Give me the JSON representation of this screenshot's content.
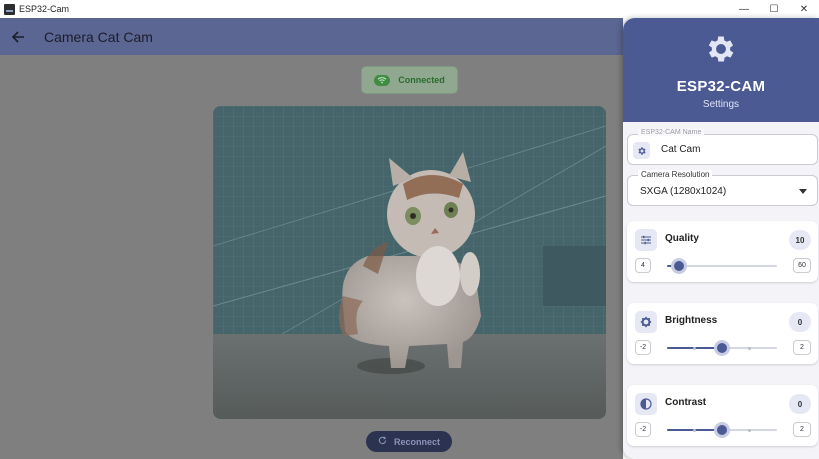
{
  "window": {
    "title": "ESP32-Cam",
    "minimize_glyph": "—",
    "maximize_glyph": "☐",
    "close_glyph": "✕"
  },
  "appbar": {
    "title": "Camera Cat Cam",
    "back_icon": "arrow-left-icon"
  },
  "status": {
    "label": "Connected",
    "icon": "wifi-icon",
    "color": "#3f8c43"
  },
  "actions": {
    "reconnect_label": "Reconnect",
    "reconnect_icon": "refresh-icon"
  },
  "settings": {
    "title": "ESP32-CAM",
    "subtitle": "Settings",
    "header_icon": "gear-icon",
    "accent_color": "#4c5a94",
    "name_field": {
      "label": "ESP32-CAM Name",
      "value": "Cat Cam",
      "icon": "settings-chip-icon"
    },
    "resolution": {
      "label": "Camera Resolution",
      "selected": "SXGA (1280x1024)"
    },
    "sliders": [
      {
        "label": "Quality",
        "icon": "tune-icon",
        "value": "10",
        "min": "4",
        "max": "60",
        "fraction": 0.107
      },
      {
        "label": "Brightness",
        "icon": "brightness-icon",
        "value": "0",
        "min": "-2",
        "max": "2",
        "fraction": 0.5
      },
      {
        "label": "Contrast",
        "icon": "contrast-icon",
        "value": "0",
        "min": "-2",
        "max": "2",
        "fraction": 0.5
      }
    ]
  }
}
